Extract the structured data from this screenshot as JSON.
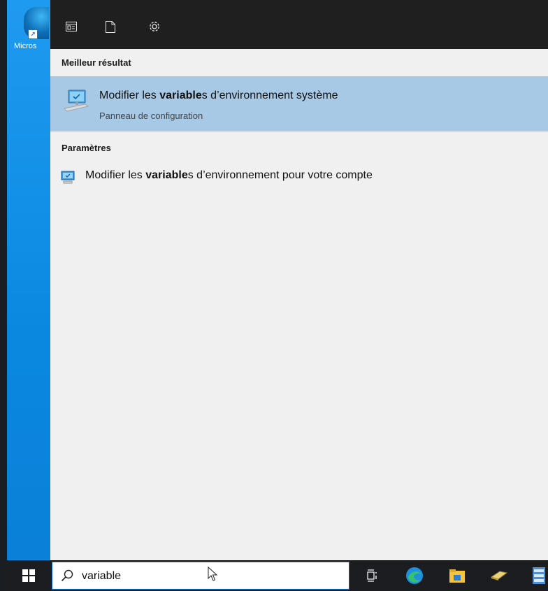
{
  "desktop": {
    "shortcut_label": "Micros"
  },
  "toolbar": {
    "icons": [
      "document-view-icon",
      "blank-document-icon",
      "gear-icon"
    ]
  },
  "results": {
    "best_header": "Meilleur résultat",
    "best": {
      "title_prefix": "Modifier les ",
      "title_match": "variable",
      "title_suffix": "s d’environnement système",
      "subtitle": "Panneau de configuration"
    },
    "settings_header": "Paramètres",
    "settings_item": {
      "title_prefix": "Modifier les ",
      "title_match": "variable",
      "title_suffix": "s d’environnement pour votre compte"
    }
  },
  "taskbar": {
    "search_value": "variable",
    "icons": [
      "start-icon",
      "task-view-icon",
      "edge-icon",
      "file-explorer-icon",
      "eraser-icon",
      "server-manager-icon"
    ]
  },
  "colors": {
    "selection": "#a8c9e6",
    "panel": "#f0f0f0",
    "toolbar": "#1f1f1f",
    "taskbar": "#1c1d21",
    "desktop": "#0a8fe0"
  }
}
